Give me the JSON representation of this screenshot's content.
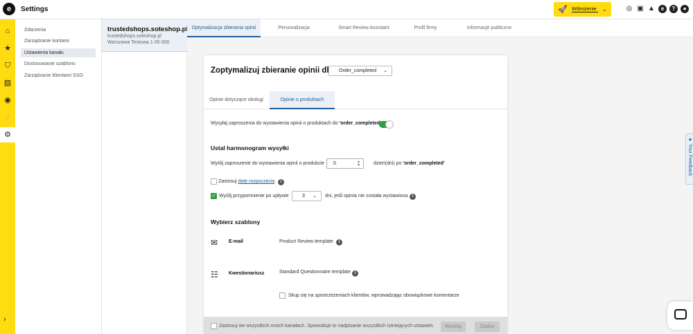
{
  "app": {
    "logo_letter": "e",
    "title": "Settings"
  },
  "header": {
    "deploy_label": "Wdrożenie",
    "icons": [
      "fingerprint-icon",
      "gift-icon",
      "bell-icon",
      "etrusted-icon",
      "help-icon",
      "user-icon"
    ]
  },
  "rail": {
    "icons": [
      "home-icon",
      "star-icon",
      "shield-icon",
      "chart-icon",
      "etrusted-icon",
      "plug-icon",
      "gear-icon"
    ],
    "active": "gear-icon"
  },
  "nav": {
    "items": [
      {
        "label": "Zdarzenia"
      },
      {
        "label": "Zarządzanie kontami"
      },
      {
        "label": "Ustawienia kanału",
        "active": true
      },
      {
        "label": "Dostosowanie szablonu"
      },
      {
        "label": "Zarządzanie klientami SSO"
      }
    ]
  },
  "shop": {
    "name": "trustedshops.soteshop.pl",
    "url": "trustedshops.soteshop.pl",
    "address": "Warszawa Testowa 1 00-300"
  },
  "tabs": [
    {
      "label": "Optymalizacja zbierania opinii",
      "active": true
    },
    {
      "label": "Personalizacja"
    },
    {
      "label": "Smart Review Assistant"
    },
    {
      "label": "Profil firmy"
    },
    {
      "label": "Informacje publiczne"
    }
  ],
  "card": {
    "title": "Zoptymalizuj zbieranie opinii dla:",
    "event_select": "Order_completed",
    "subtabs": [
      {
        "label": "Opinie dotyczące obsługi"
      },
      {
        "label": "Opinie o produktach",
        "active": true
      }
    ],
    "invite_toggle": {
      "label_prefix": "Wysyłaj zaproszenia do wystawienia opinii o produktach do ",
      "label_event": "'order_completed'",
      "on": true
    },
    "schedule": {
      "title": "Ustal harmonogram wysyłki",
      "send_prefix": "Wyślij zaproszenie do wystawienia opinii o produkcie",
      "days_value": "0",
      "send_suffix": "dzień(dni) po ",
      "send_event": "'order_completed'",
      "start_date_prefix": "Zastosuj ",
      "start_date_link": "datę rozpoczęcia",
      "start_date_checked": false,
      "reminder_label": "Wyślij przypomnienie po upływie",
      "reminder_checked": true,
      "reminder_value": "3",
      "reminder_suffix": "dni, jeśli opinia nie została wystawiona"
    },
    "templates": {
      "title": "Wybierz szablony",
      "email_label": "E-mail",
      "email_template": "Product Review template",
      "questionnaire_label": "Kwestionariusz",
      "questionnaire_template": "Standard Questionnaire template",
      "focus_label": "Skup się na spostrzeżeniach klientów, wprowadzając obowiązkowe komentarze",
      "focus_checked": false
    },
    "footer": {
      "apply_all_label": "Zastosuj we wszystkich moich kanałach. Spowoduje to nadpisanie wszystkich istniejących ustawień.",
      "reset_label": "Resetuj",
      "save_label": "Zapisz"
    }
  },
  "feedback": {
    "label": "★ Your Feedback"
  }
}
